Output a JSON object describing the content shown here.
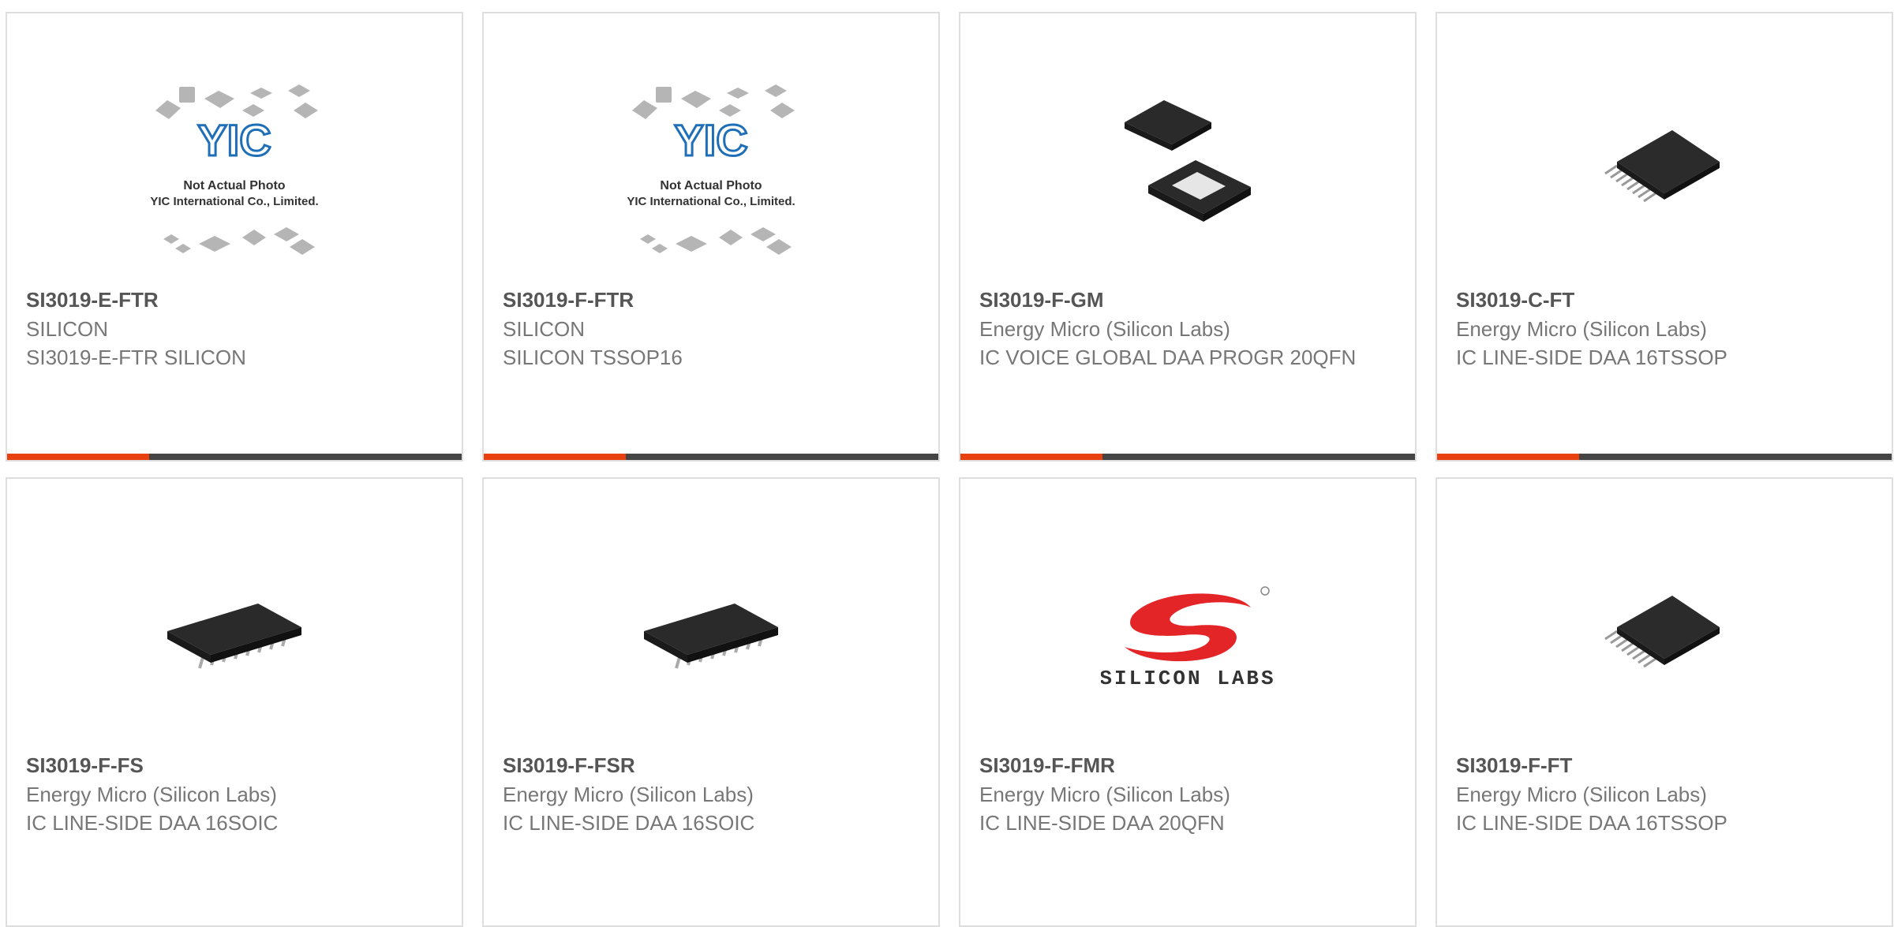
{
  "colors": {
    "accent": "#e8400f",
    "bar": "#444444",
    "border": "#dedede",
    "text_bold": "#555555",
    "text": "#777777",
    "brand_red": "#e42528"
  },
  "products": [
    {
      "part_number": "SI3019-E-FTR",
      "manufacturer": "SILICON",
      "description": "SI3019-E-FTR SILICON",
      "image": "not-actual-photo-icon",
      "placeholder": {
        "logo": "YIC",
        "line1": "Not Actual Photo",
        "line2": "YIC International Co., Limited."
      }
    },
    {
      "part_number": "SI3019-F-FTR",
      "manufacturer": "SILICON",
      "description": "SILICON TSSOP16",
      "image": "not-actual-photo-icon",
      "placeholder": {
        "logo": "YIC",
        "line1": "Not Actual Photo",
        "line2": "YIC International Co., Limited."
      }
    },
    {
      "part_number": "SI3019-F-GM",
      "manufacturer": "Energy Micro (Silicon Labs)",
      "description": "IC VOICE GLOBAL DAA PROGR 20QFN",
      "image": "qfn-chip-icon"
    },
    {
      "part_number": "SI3019-C-FT",
      "manufacturer": "Energy Micro (Silicon Labs)",
      "description": "IC LINE-SIDE DAA 16TSSOP",
      "image": "tssop-chip-icon"
    },
    {
      "part_number": "SI3019-F-FS",
      "manufacturer": "Energy Micro (Silicon Labs)",
      "description": "IC LINE-SIDE DAA 16SOIC",
      "image": "soic-chip-icon"
    },
    {
      "part_number": "SI3019-F-FSR",
      "manufacturer": "Energy Micro (Silicon Labs)",
      "description": "IC LINE-SIDE DAA 16SOIC",
      "image": "soic-chip-icon"
    },
    {
      "part_number": "SI3019-F-FMR",
      "manufacturer": "Energy Micro (Silicon Labs)",
      "description": "IC LINE-SIDE DAA 20QFN",
      "image": "silicon-labs-logo",
      "logo_text": "SILICON LABS"
    },
    {
      "part_number": "SI3019-F-FT",
      "manufacturer": "Energy Micro (Silicon Labs)",
      "description": "IC LINE-SIDE DAA 16TSSOP",
      "image": "tssop-chip-icon"
    }
  ]
}
